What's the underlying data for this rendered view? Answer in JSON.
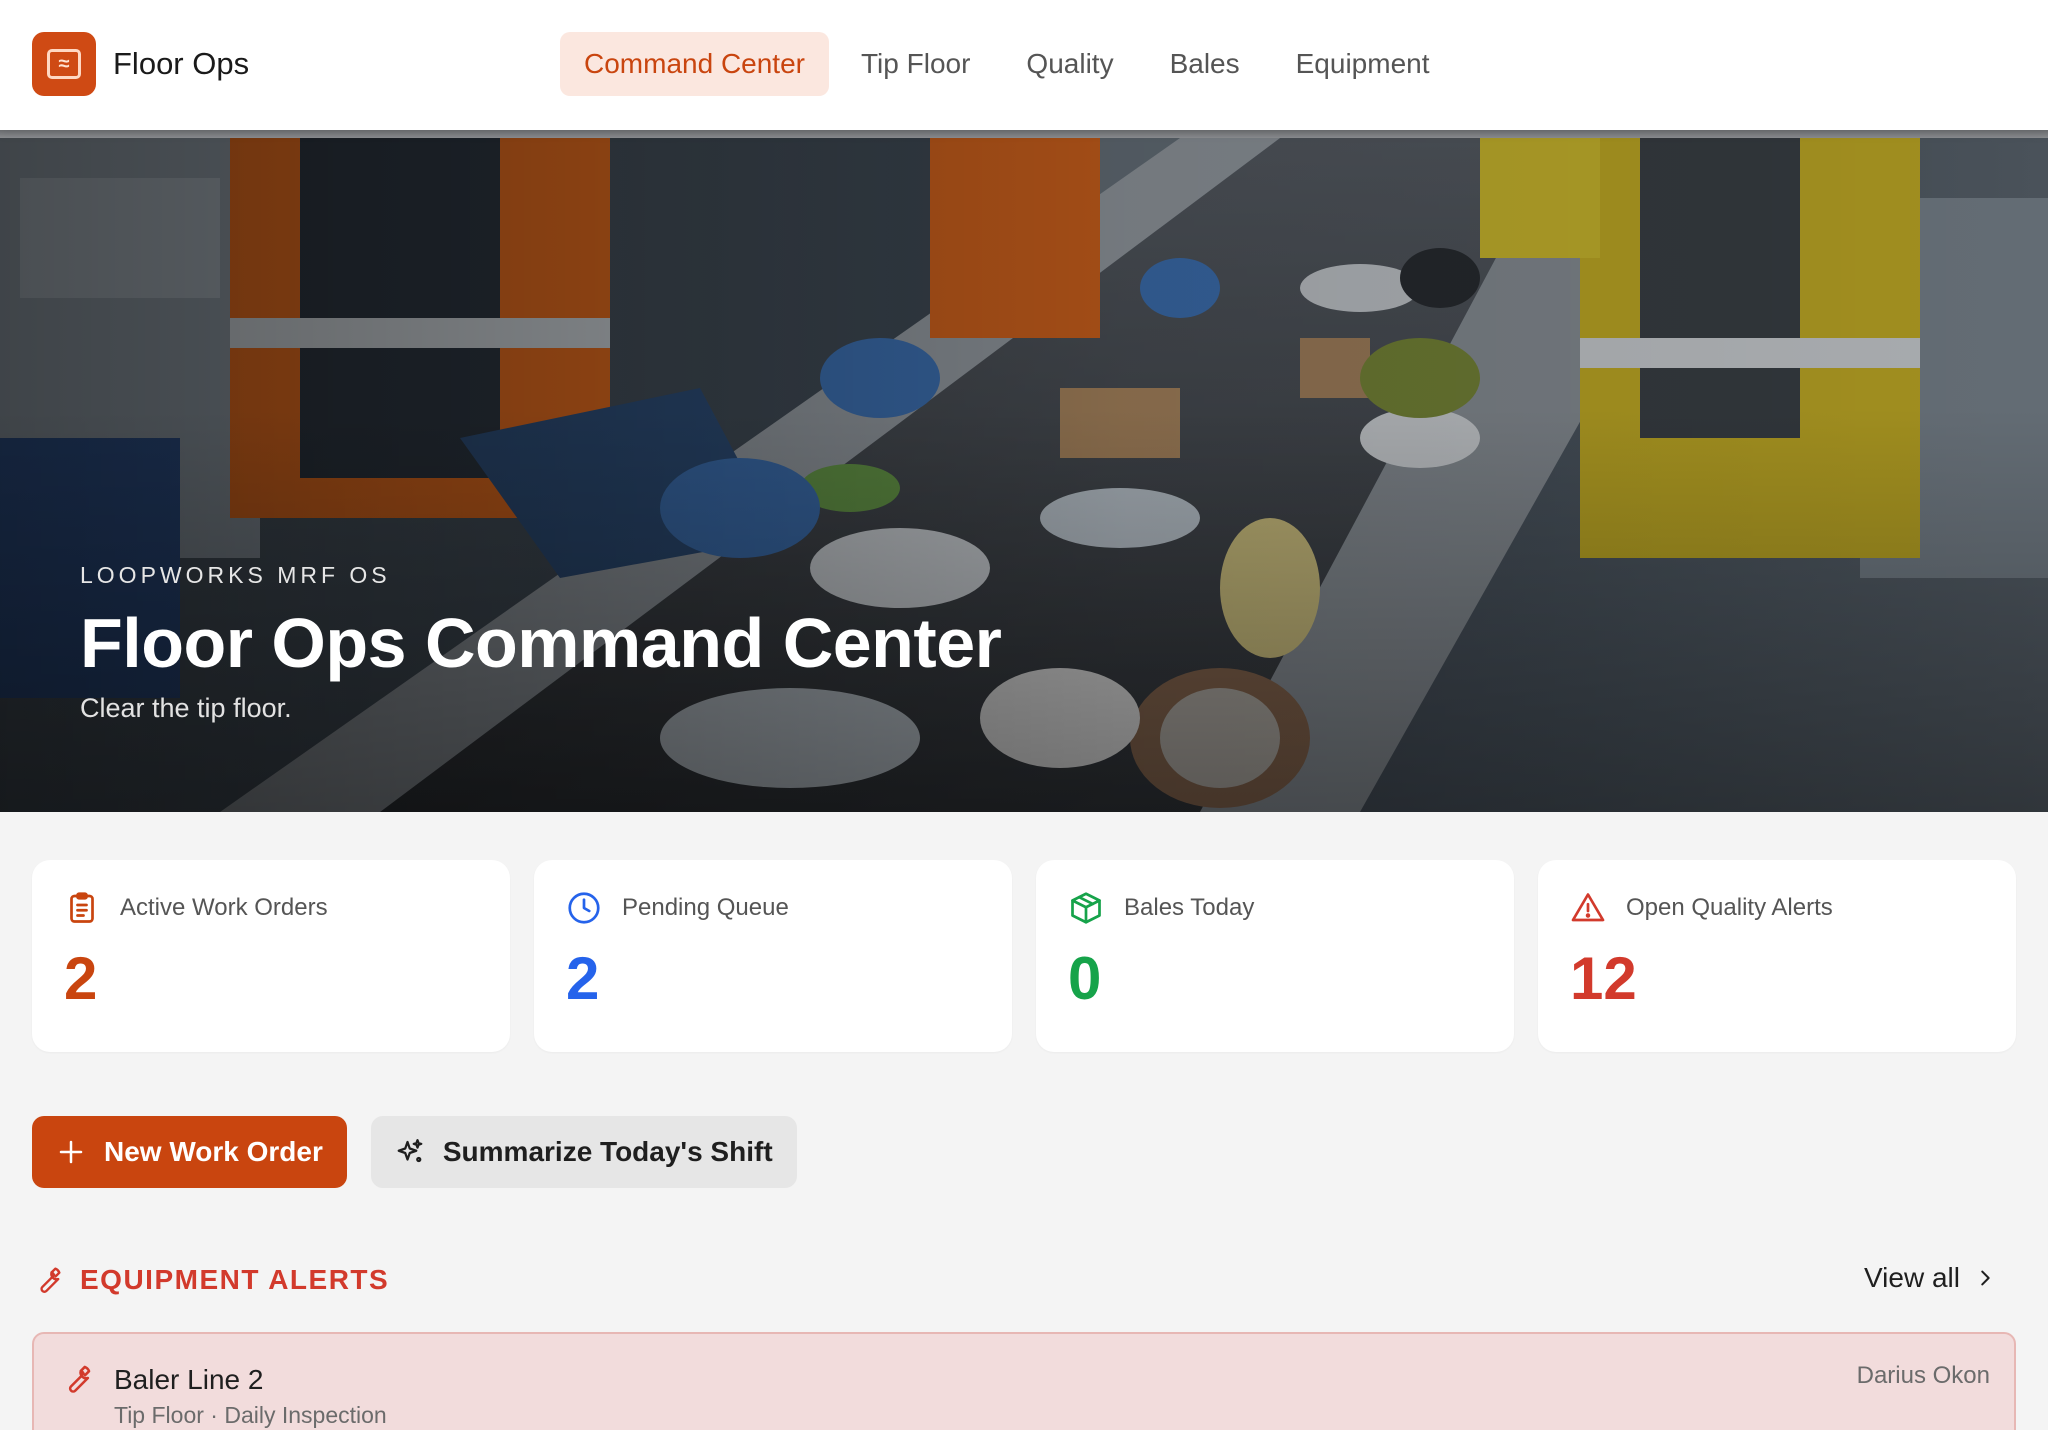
{
  "brand": {
    "name": "Floor Ops"
  },
  "nav": {
    "items": [
      {
        "label": "Command Center",
        "active": true
      },
      {
        "label": "Tip Floor",
        "active": false
      },
      {
        "label": "Quality",
        "active": false
      },
      {
        "label": "Bales",
        "active": false
      },
      {
        "label": "Equipment",
        "active": false
      }
    ]
  },
  "hero": {
    "eyebrow": "LOOPWORKS MRF OS",
    "title": "Floor Ops Command Center",
    "subtitle": "Clear the tip floor."
  },
  "stats": [
    {
      "label": "Active Work Orders",
      "value": "2",
      "color": "#c9450f",
      "icon": "clipboard-icon"
    },
    {
      "label": "Pending Queue",
      "value": "2",
      "color": "#2563eb",
      "icon": "clock-icon"
    },
    {
      "label": "Bales Today",
      "value": "0",
      "color": "#16a34a",
      "icon": "box-icon"
    },
    {
      "label": "Open Quality Alerts",
      "value": "12",
      "color": "#d23a2c",
      "icon": "warning-icon"
    }
  ],
  "actions": {
    "new_work_order": "New Work Order",
    "summarize_shift": "Summarize Today's Shift"
  },
  "equipment_alerts": {
    "title": "EQUIPMENT ALERTS",
    "view_all": "View all",
    "items": [
      {
        "title": "Baler Line 2",
        "subtitle": "Tip Floor · Daily Inspection",
        "owner": "Darius Okon"
      }
    ]
  },
  "colors": {
    "accent": "#c9450f",
    "alert": "#d23a2c",
    "alert_bg": "#f2dcdc"
  }
}
